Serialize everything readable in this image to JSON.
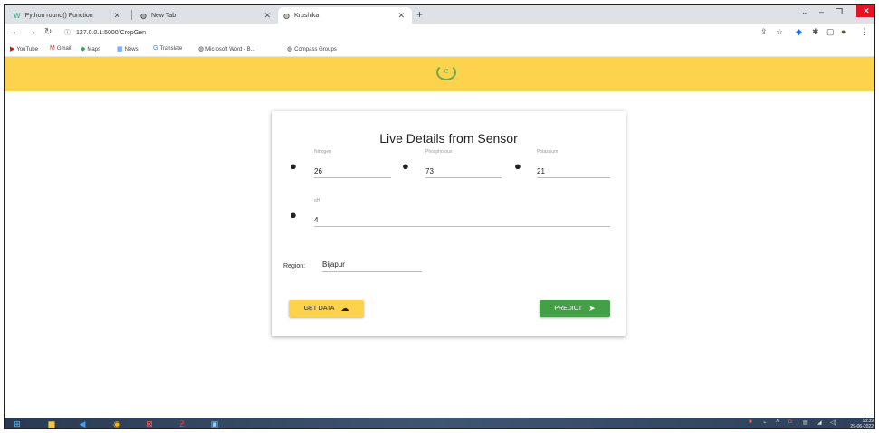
{
  "browser": {
    "tabs": [
      {
        "icon": "W",
        "label": "Python round() Function"
      },
      {
        "icon": "◍",
        "label": "New Tab"
      },
      {
        "icon": "◍",
        "label": "Krushika"
      }
    ],
    "url": "127.0.0.1:5000/CropGen",
    "bookmarks": [
      {
        "icon": "▶",
        "label": "YouTube",
        "color": "#ff0000"
      },
      {
        "icon": "M",
        "label": "Gmail",
        "color": "#d93025"
      },
      {
        "icon": "◆",
        "label": "Maps",
        "color": "#34a853"
      },
      {
        "icon": "▦",
        "label": "News",
        "color": "#4285f4"
      },
      {
        "icon": "G",
        "label": "Translate",
        "color": "#4285f4"
      },
      {
        "icon": "◍",
        "label": "Microsoft Word - B...",
        "color": "#444444"
      },
      {
        "icon": "◍",
        "label": "Compass Groups",
        "color": "#444444"
      }
    ]
  },
  "card": {
    "title": "Live Details from Sensor",
    "nitrogen": {
      "label": "Nitrogen",
      "value": "26"
    },
    "phosphorous": {
      "label": "Phosphorous",
      "value": "73"
    },
    "potassium": {
      "label": "Potassium",
      "value": "21"
    },
    "ph": {
      "label": "pH",
      "value": "4"
    },
    "region": {
      "label": "Region:",
      "value": "Bijapur"
    },
    "get_data_label": "GET DATA",
    "predict_label": "PREDICT"
  },
  "taskbar": {
    "time": "13:39",
    "date": "29-06-2022"
  },
  "colors": {
    "header_yellow": "#fdd34d",
    "predict_green": "#43a047"
  }
}
